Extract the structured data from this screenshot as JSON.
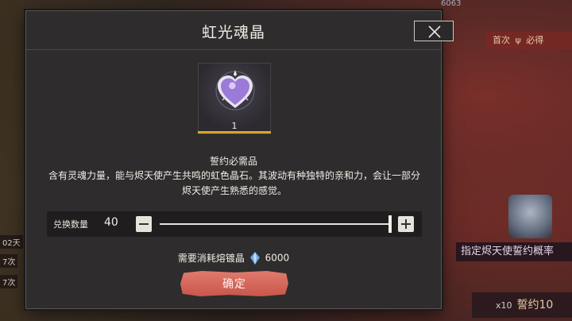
{
  "dialog": {
    "title": "虹光魂晶",
    "close_icon": "close-icon"
  },
  "item": {
    "icon": "heart-crystal-icon",
    "quantity": "1",
    "accent_color": "#d9a52a"
  },
  "description": {
    "title": "誓约必需品",
    "body": "含有灵魂力量，能与烬天使产生共鸣的虹色晶石。其波动有种独特的亲和力，会让一部分烬天使产生熟悉的感觉。"
  },
  "exchange": {
    "label": "兑换数量",
    "value": "40",
    "slider_fraction": 1.0
  },
  "cost": {
    "label": "需要消耗熔镀晶",
    "icon": "crystal-gem-icon",
    "amount": "6000"
  },
  "confirm": {
    "label": "确定"
  },
  "background": {
    "top_number": "6063",
    "first_time_tag": "首次",
    "first_time_suffix": "必得",
    "left_tag_1": "02天",
    "left_tag_2": "7次",
    "left_tag_3": "7次",
    "right_banner": "指定烬天使誓约概率",
    "bottom_right": "誓约10",
    "bottom_right_count": "x10"
  }
}
